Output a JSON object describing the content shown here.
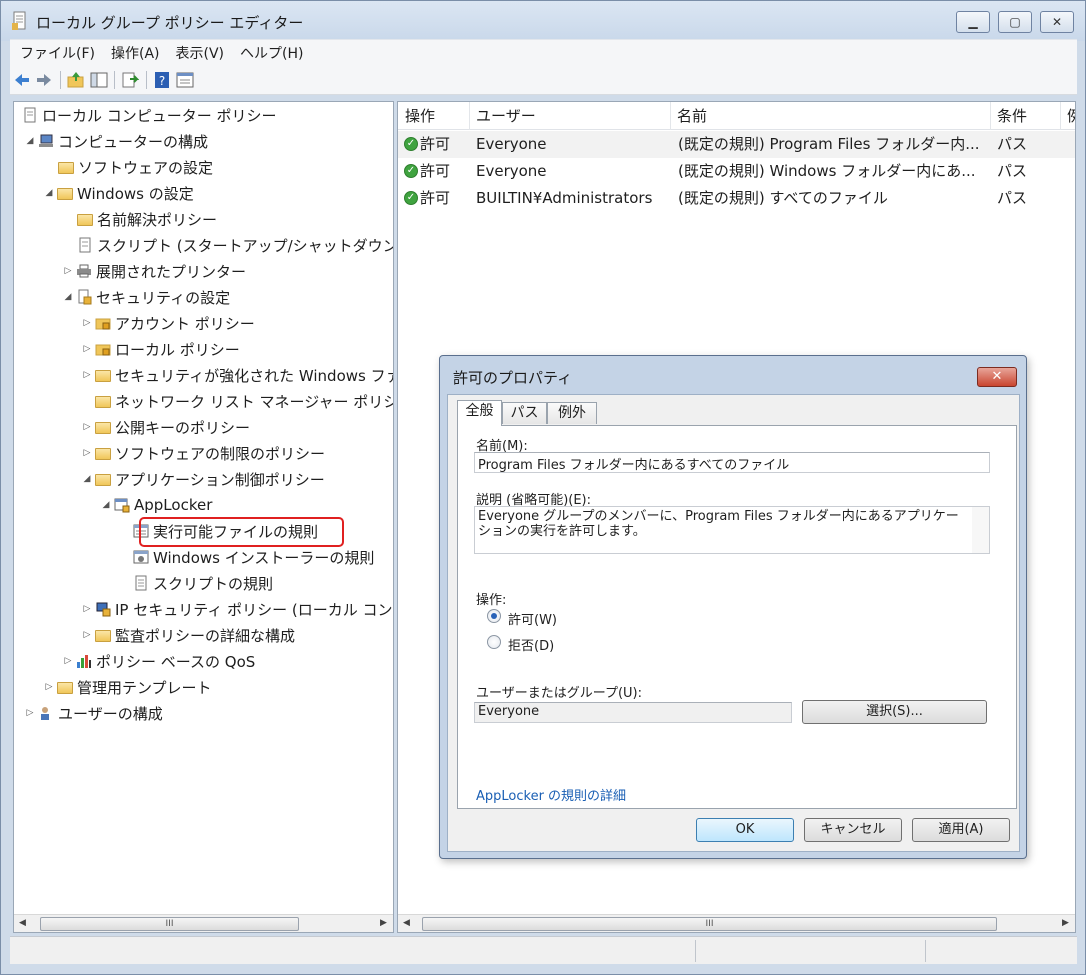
{
  "window": {
    "title": "ローカル グループ ポリシー エディター",
    "caption_buttons": {
      "minimize": "▁",
      "maximize": "▢",
      "close": "✕"
    }
  },
  "menu": [
    "ファイル(F)",
    "操作(A)",
    "表示(V)",
    "ヘルプ(H)"
  ],
  "toolbar_icons": [
    "back-arrow-icon",
    "forward-arrow-icon",
    "up-folder-icon",
    "show-hide-tree-icon",
    "export-list-icon",
    "help-icon",
    "properties-icon"
  ],
  "tree": {
    "root": "ローカル コンピューター ポリシー",
    "computer_config": "コンピューターの構成",
    "software_settings": "ソフトウェアの設定",
    "windows_settings": "Windows の設定",
    "name_resolution": "名前解決ポリシー",
    "scripts": "スクリプト (スタートアップ/シャットダウン)",
    "deployed_printers": "展開されたプリンター",
    "security_settings": "セキュリティの設定",
    "account_policy": "アカウント ポリシー",
    "local_policy": "ローカル ポリシー",
    "firewall": "セキュリティが強化された Windows ファイアウォール",
    "network_list": "ネットワーク リスト マネージャー ポリシー",
    "public_key": "公開キーのポリシー",
    "software_restriction": "ソフトウェアの制限のポリシー",
    "app_control": "アプリケーション制御ポリシー",
    "applocker": "AppLocker",
    "exe_rules": "実行可能ファイルの規則",
    "installer_rules": "Windows インストーラーの規則",
    "script_rules": "スクリプトの規則",
    "ip_security": "IP セキュリティ ポリシー (ローカル コンピューター)",
    "audit_policy": "監査ポリシーの詳細な構成",
    "qos": "ポリシー ベースの QoS",
    "admin_templates": "管理用テンプレート",
    "user_config": "ユーザーの構成"
  },
  "list": {
    "columns": [
      "操作",
      "ユーザー",
      "名前",
      "条件",
      "例"
    ],
    "rows": [
      {
        "action": "許可",
        "user": "Everyone",
        "name": "(既定の規則) Program Files フォルダー内...",
        "condition": "パス"
      },
      {
        "action": "許可",
        "user": "Everyone",
        "name": "(既定の規則) Windows フォルダー内にあ...",
        "condition": "パス"
      },
      {
        "action": "許可",
        "user": "BUILTIN¥Administrators",
        "name": "(既定の規則) すべてのファイル",
        "condition": "パス"
      }
    ]
  },
  "scrollbar": {
    "thumb_grip": "III",
    "left": "◀",
    "right": "▶"
  },
  "dialog": {
    "title": "許可のプロパティ",
    "close": "✕",
    "tabs": [
      "全般",
      "パス",
      "例外"
    ],
    "name_label": "名前(M):",
    "name_value": "Program Files フォルダー内にあるすべてのファイル",
    "desc_label": "説明 (省略可能)(E):",
    "desc_value": "Everyone グループのメンバーに、Program Files フォルダー内にあるアプリケーションの実行を許可します。",
    "action_label": "操作:",
    "allow_label": "許可(W)",
    "deny_label": "拒否(D)",
    "user_label": "ユーザーまたはグループ(U):",
    "user_value": "Everyone",
    "select_button": "選択(S)...",
    "link": "AppLocker の規則の詳細",
    "ok": "OK",
    "cancel": "キャンセル",
    "apply": "適用(A)"
  }
}
